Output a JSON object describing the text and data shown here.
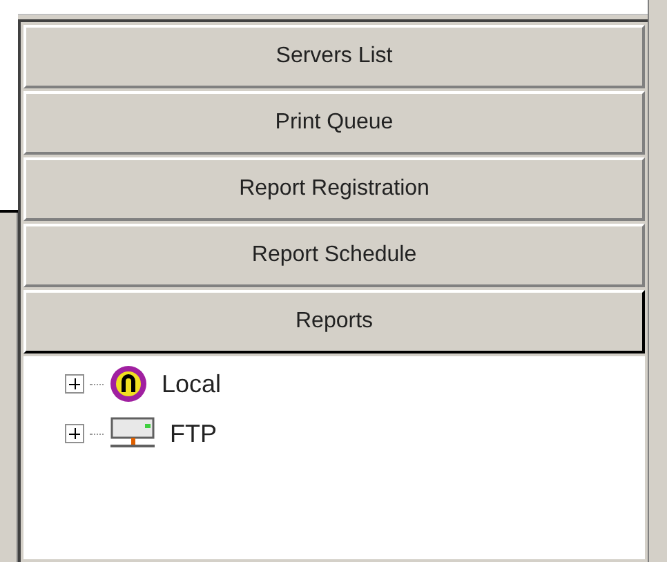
{
  "buttons": [
    {
      "label": "Servers List",
      "selected": false
    },
    {
      "label": "Print Queue",
      "selected": false
    },
    {
      "label": "Report Registration",
      "selected": false
    },
    {
      "label": "Report Schedule",
      "selected": false
    },
    {
      "label": "Reports",
      "selected": true
    }
  ],
  "tree": [
    {
      "label": "Local",
      "kind": "local",
      "expanded": false
    },
    {
      "label": "FTP",
      "kind": "ftp",
      "expanded": false
    }
  ]
}
